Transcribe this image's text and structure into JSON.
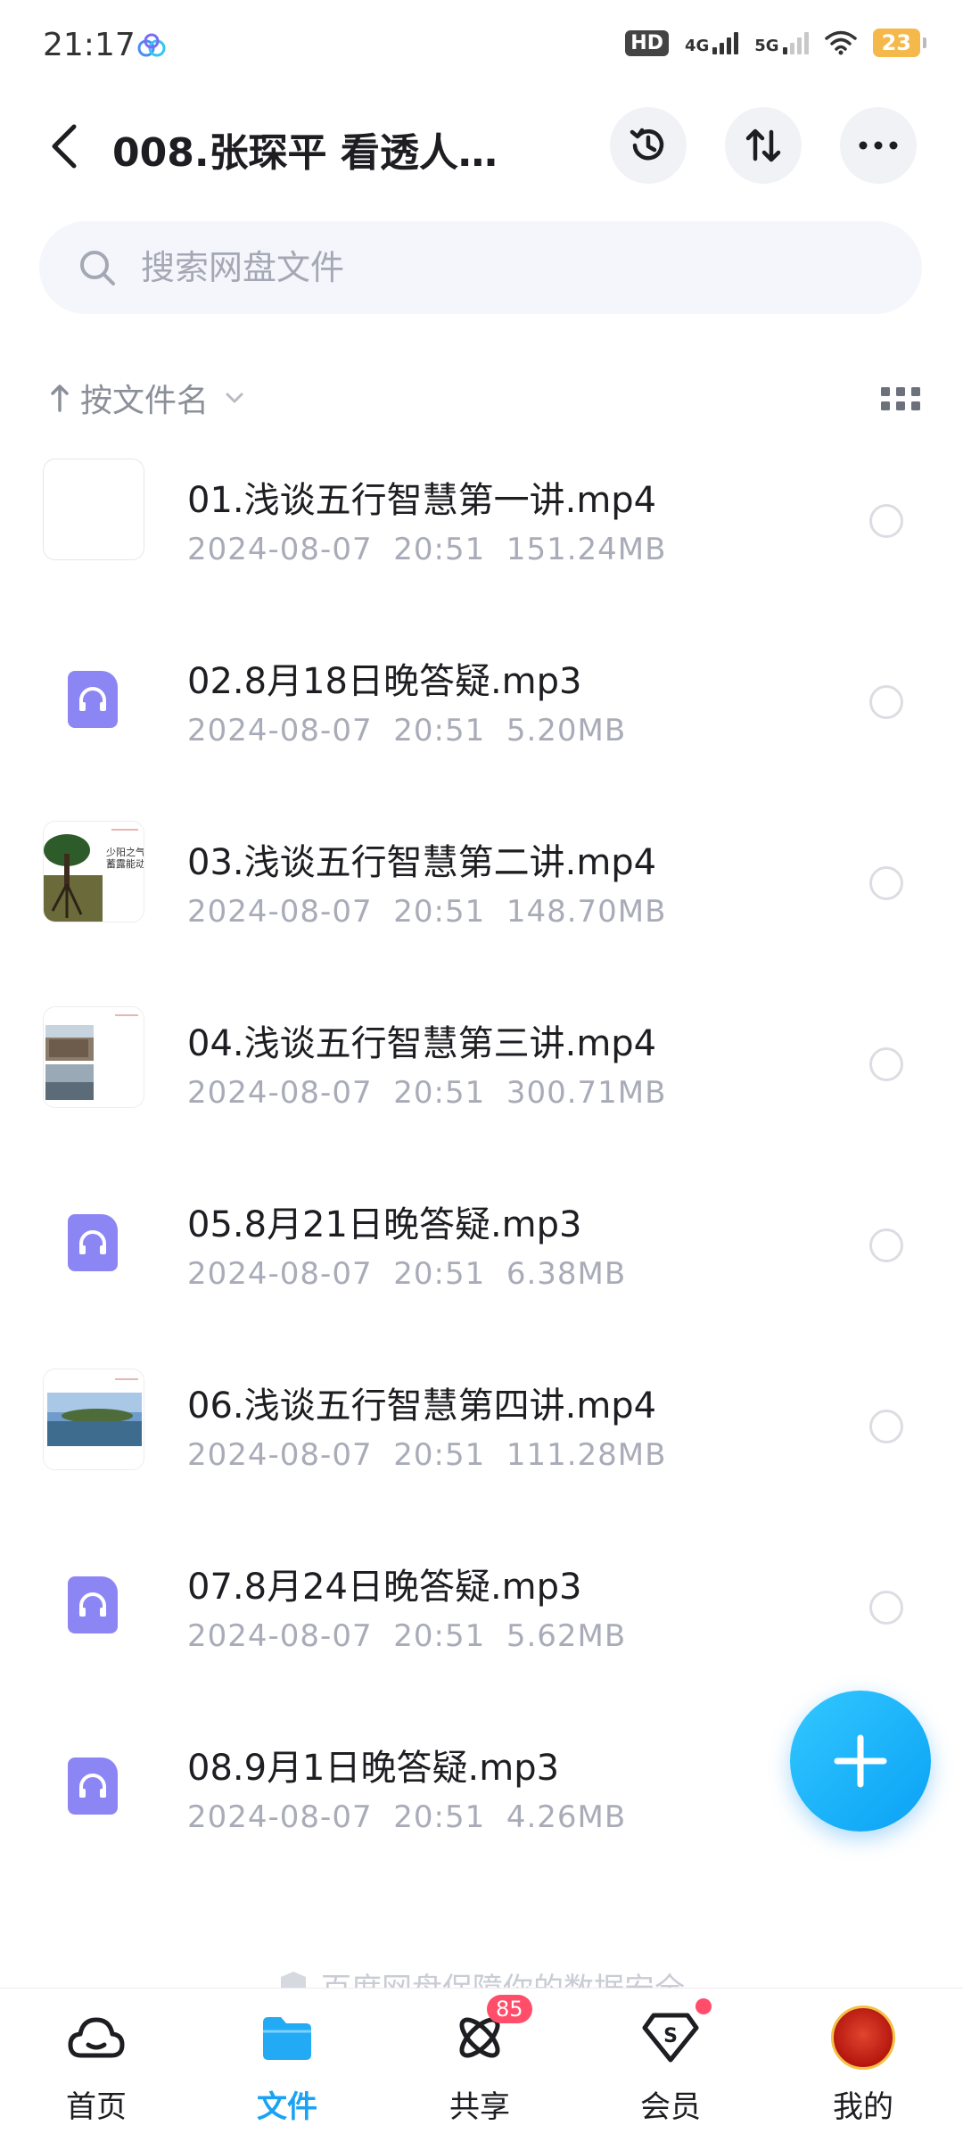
{
  "status_bar": {
    "time": "21:17",
    "hd": "HD",
    "net1": "4G",
    "net2": "5G",
    "battery": "23"
  },
  "header": {
    "title": "008.张琛平 看透人…"
  },
  "search": {
    "placeholder": "搜索网盘文件"
  },
  "sort": {
    "label": "按文件名"
  },
  "files": [
    {
      "name": "01.浅谈五行智慧第一讲.mp4",
      "date": "2024-08-07",
      "time": "20:51",
      "size": "151.24MB"
    },
    {
      "name": "02.8月18日晚答疑.mp3",
      "date": "2024-08-07",
      "time": "20:51",
      "size": "5.20MB"
    },
    {
      "name": "03.浅谈五行智慧第二讲.mp4",
      "date": "2024-08-07",
      "time": "20:51",
      "size": "148.70MB"
    },
    {
      "name": "04.浅谈五行智慧第三讲.mp4",
      "date": "2024-08-07",
      "time": "20:51",
      "size": "300.71MB"
    },
    {
      "name": "05.8月21日晚答疑.mp3",
      "date": "2024-08-07",
      "time": "20:51",
      "size": "6.38MB"
    },
    {
      "name": "06.浅谈五行智慧第四讲.mp4",
      "date": "2024-08-07",
      "time": "20:51",
      "size": "111.28MB"
    },
    {
      "name": "07.8月24日晚答疑.mp3",
      "date": "2024-08-07",
      "time": "20:51",
      "size": "5.62MB"
    },
    {
      "name": "08.9月1日晚答疑.mp3",
      "date": "2024-08-07",
      "time": "20:51",
      "size": "4.26MB"
    }
  ],
  "thumb_text": {
    "f03": "少阳之气，\n蓄露能动"
  },
  "footer_note": "百度网盘保障你的数据安全",
  "tabs": {
    "home": "首页",
    "files": "文件",
    "share": "共享",
    "share_badge": "85",
    "vip": "会员",
    "mine": "我的"
  },
  "colors": {
    "accent": "#1aa3f4",
    "audio_icon": "#8c86f5",
    "badge": "#ff4d6a"
  }
}
